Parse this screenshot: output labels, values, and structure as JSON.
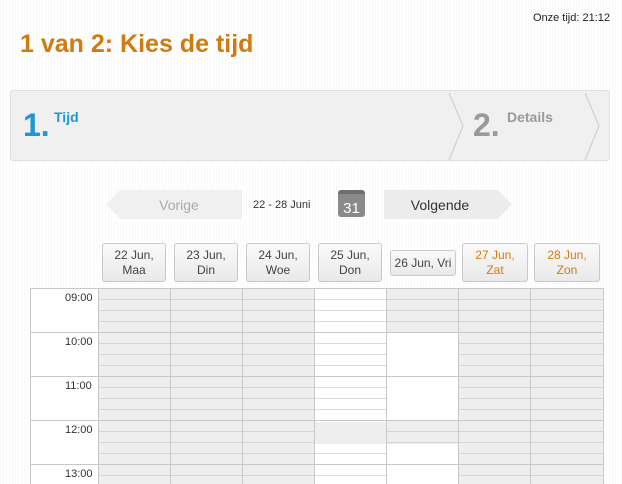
{
  "clock": "Onze tijd: 21:12",
  "page_title": "1 van 2: Kies de tijd",
  "steps": [
    {
      "num": "1.",
      "label": "Tijd",
      "active": true
    },
    {
      "num": "2.",
      "label": "Details",
      "active": false
    }
  ],
  "nav": {
    "prev_label": "Vorige",
    "range": "22 - 28 Juni",
    "calendar_day": "31",
    "next_label": "Volgende"
  },
  "days": [
    {
      "label1": "22 Jun,",
      "label2": "Maa",
      "weekend": false
    },
    {
      "label1": "23 Jun,",
      "label2": "Din",
      "weekend": false
    },
    {
      "label1": "24 Jun,",
      "label2": "Woe",
      "weekend": false
    },
    {
      "label1": "25 Jun,",
      "label2": "Don",
      "weekend": false
    },
    {
      "label1": "26 Jun, Vri",
      "label2": "",
      "weekend": false
    },
    {
      "label1": "27 Jun,",
      "label2": "Zat",
      "weekend": true
    },
    {
      "label1": "28 Jun,",
      "label2": "Zon",
      "weekend": true
    }
  ],
  "times": [
    "09:00",
    "10:00",
    "11:00",
    "12:00",
    "13:00"
  ],
  "colors": {
    "accent_orange": "#d07a12",
    "step_active_blue": "#2196d4",
    "step_inactive_gray": "#9a9a9a"
  }
}
